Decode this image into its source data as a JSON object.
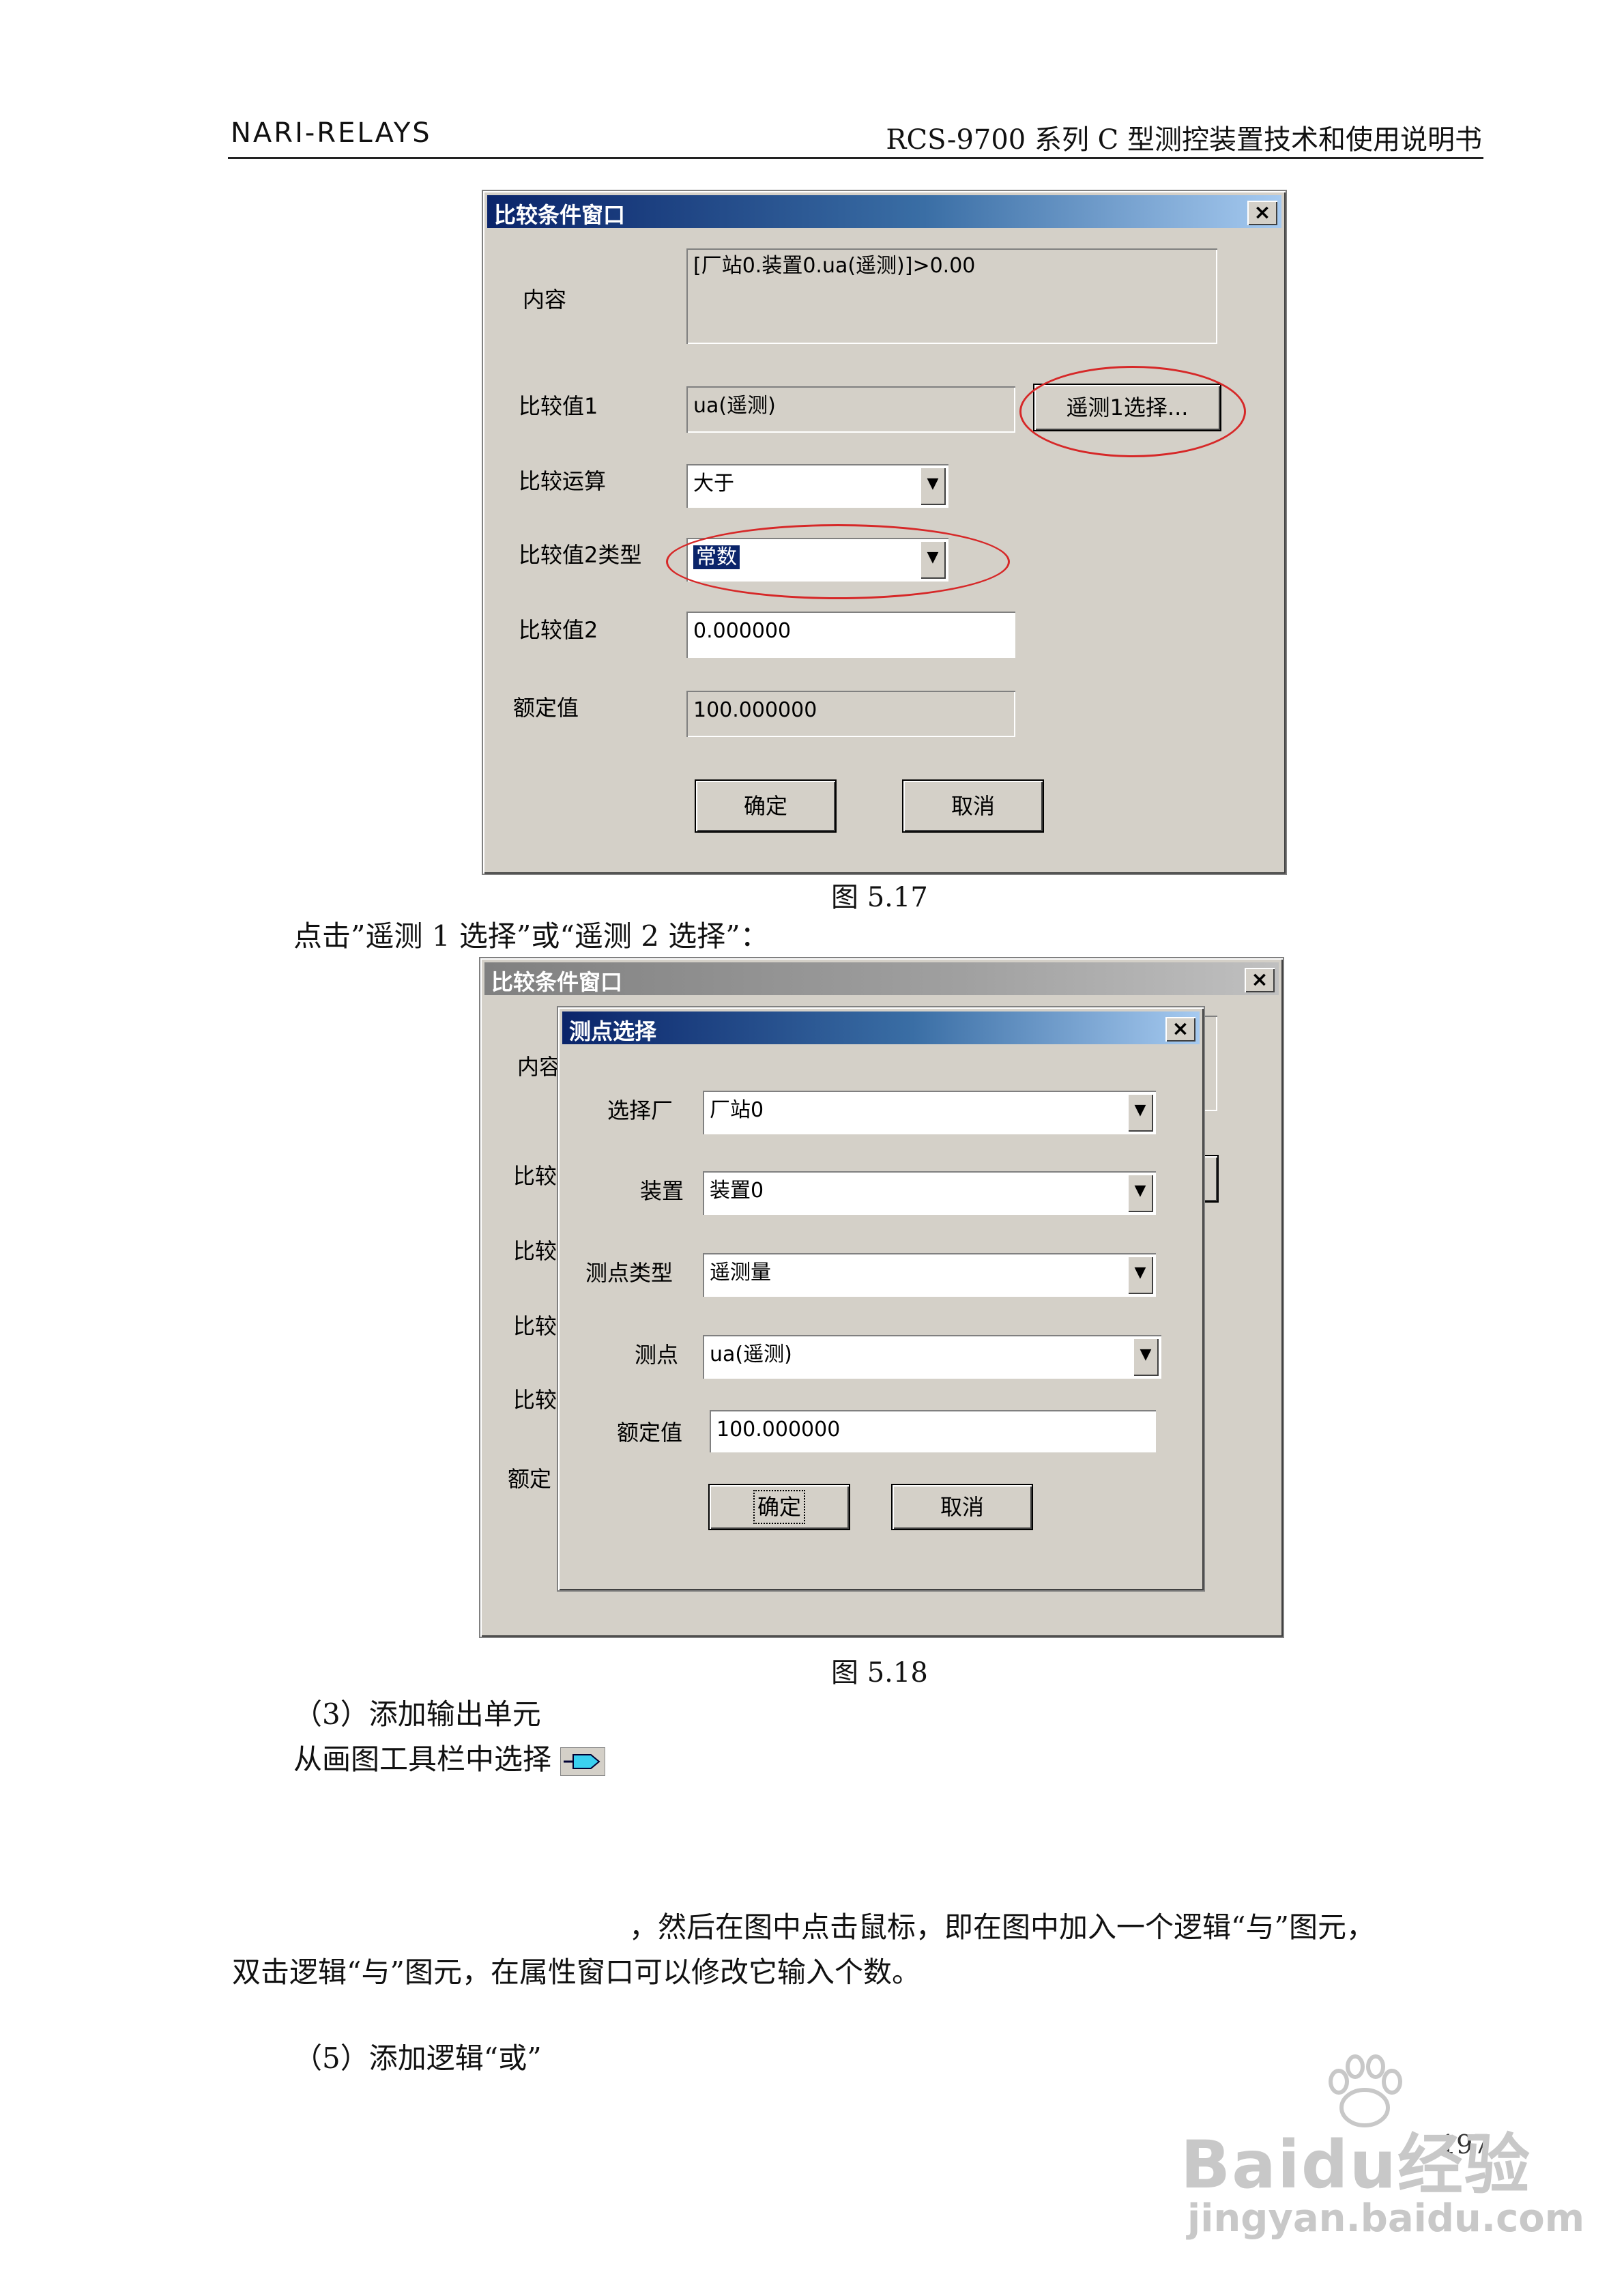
{
  "header": {
    "brand": "NARI-RELAYS",
    "doc_title": "RCS-9700 系列 C 型测控装置技术和使用说明书"
  },
  "fig1": {
    "title": "比较条件窗口",
    "close": "×",
    "content_label": "内容",
    "content_value": "[厂站0.装置0.ua(遥测)]>0.00",
    "cmp1_label": "比较值1",
    "cmp1_value": "ua(遥测)",
    "cmp1_button": "遥测1选择...",
    "op_label": "比较运算",
    "op_value": "大于",
    "type2_label": "比较值2类型",
    "type2_value": "常数",
    "cmp2_label": "比较值2",
    "cmp2_value": "0.000000",
    "rated_label": "额定值",
    "rated_value": "100.000000",
    "ok": "确定",
    "cancel": "取消",
    "caption": "图 5.17"
  },
  "text_between": "点击”遥测 1 选择”或“遥测 2 选择”：",
  "fig2": {
    "bg_title": "比较条件窗口",
    "bg_close": "×",
    "bg_labels": [
      "内容",
      "比较",
      "比较",
      "比较",
      "比较",
      "额定"
    ],
    "dialog_title": "测点选择",
    "close": "×",
    "factory_label": "选择厂",
    "factory_value": "厂站0",
    "device_label": "装置",
    "device_value": "装置0",
    "point_type_label": "测点类型",
    "point_type_value": "遥测量",
    "point_label": "测点",
    "point_value": "ua(遥测)",
    "rated_label": "额定值",
    "rated_value": "100.000000",
    "ok": "确定",
    "cancel": "取消",
    "caption": "图 5.18"
  },
  "section3_heading": "（3）添加输出单元",
  "section3_line": "从画图工具栏中选择",
  "para_line1": "，然后在图中点击鼠标，即在图中加入一个逻辑“与”图元，",
  "para_line2": "双击逻辑“与”图元，在属性窗口可以修改它输入个数。",
  "section5_heading": "（5）添加逻辑“或”",
  "page_number": "197",
  "watermark": {
    "logo": "Baidu经验",
    "url": "jingyan.baidu.com"
  }
}
